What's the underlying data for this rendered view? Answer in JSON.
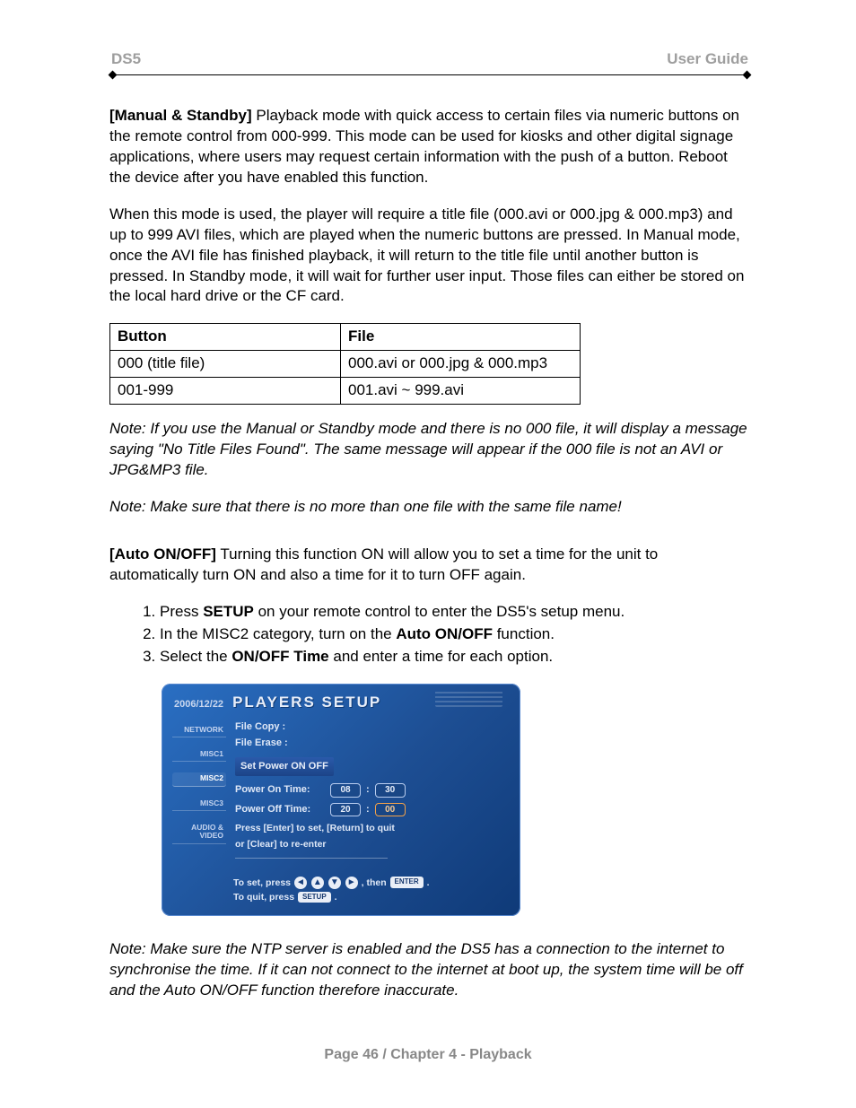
{
  "header": {
    "left": "DS5",
    "right": "User Guide"
  },
  "para1_lead": "[Manual & Standby]",
  "para1_rest": " Playback mode with quick access to certain files via numeric buttons on the remote control from 000-999. This mode can be used for kiosks and other digital signage applications, where users may request certain information with the push of a button. Reboot the device after you have enabled this function.",
  "para2": "When this mode is used, the player will require a title file (000.avi or 000.jpg & 000.mp3) and up to 999 AVI files, which are played when the numeric buttons are pressed. In Manual mode, once the AVI file has finished playback, it will return to the title file until another button is pressed. In Standby mode, it will wait for further user input. Those files can either be stored on the local hard drive or the CF card.",
  "table": {
    "head": [
      "Button",
      "File"
    ],
    "rows": [
      [
        "000 (title file)",
        "000.avi or 000.jpg & 000.mp3"
      ],
      [
        "001-999",
        "001.avi ~ 999.avi"
      ]
    ]
  },
  "note1": "Note: If you use the Manual or Standby mode and there is no 000 file, it will display a message saying \"No Title Files Found\". The same message will appear if the 000 file is not an AVI or JPG&MP3 file.",
  "note2": "Note: Make sure that there is no more than one file with the same file name!",
  "auto_lead": "[Auto ON/OFF]",
  "auto_rest": " Turning this function ON will allow you to set a time for the unit to automatically turn ON and also a time for it to turn OFF again.",
  "steps": {
    "s1a": "Press ",
    "s1b": "SETUP",
    "s1c": " on your remote control to enter the DS5's setup menu.",
    "s2a": "In the MISC2 category, turn on the ",
    "s2b": "Auto ON/OFF",
    "s2c": " function.",
    "s3a": "Select the ",
    "s3b": "ON/OFF Time",
    "s3c": " and enter a time for each option."
  },
  "setup": {
    "date": "2006/12/22",
    "title": "PLAYERS SETUP",
    "side": [
      "NETWORK",
      "MISC1",
      "MISC2",
      "MISC3",
      "AUDIO & VIDEO"
    ],
    "pane": {
      "file_copy": "File Copy :",
      "file_erase": "File Erase :",
      "sub": "Set Power ON OFF",
      "on_label": "Power On Time:",
      "off_label": "Power Off Time:",
      "on_h": "08",
      "on_m": "30",
      "off_h": "20",
      "off_m": "00",
      "hint1": "Press [Enter] to set, [Return] to quit",
      "hint2": "or [Clear] to re-enter"
    },
    "foot": {
      "line1a": "To set, press",
      "line1b": ", then",
      "enter": "ENTER",
      "dot": ".",
      "line2a": "To quit, press",
      "setup": "SETUP"
    }
  },
  "note3": "Note: Make sure the NTP server is enabled and the DS5 has a connection to the internet to synchronise the time. If it can not connect to the internet at boot up, the system time will be off and the Auto ON/OFF function therefore inaccurate.",
  "footer": "Page 46  /  Chapter 4 - Playback"
}
